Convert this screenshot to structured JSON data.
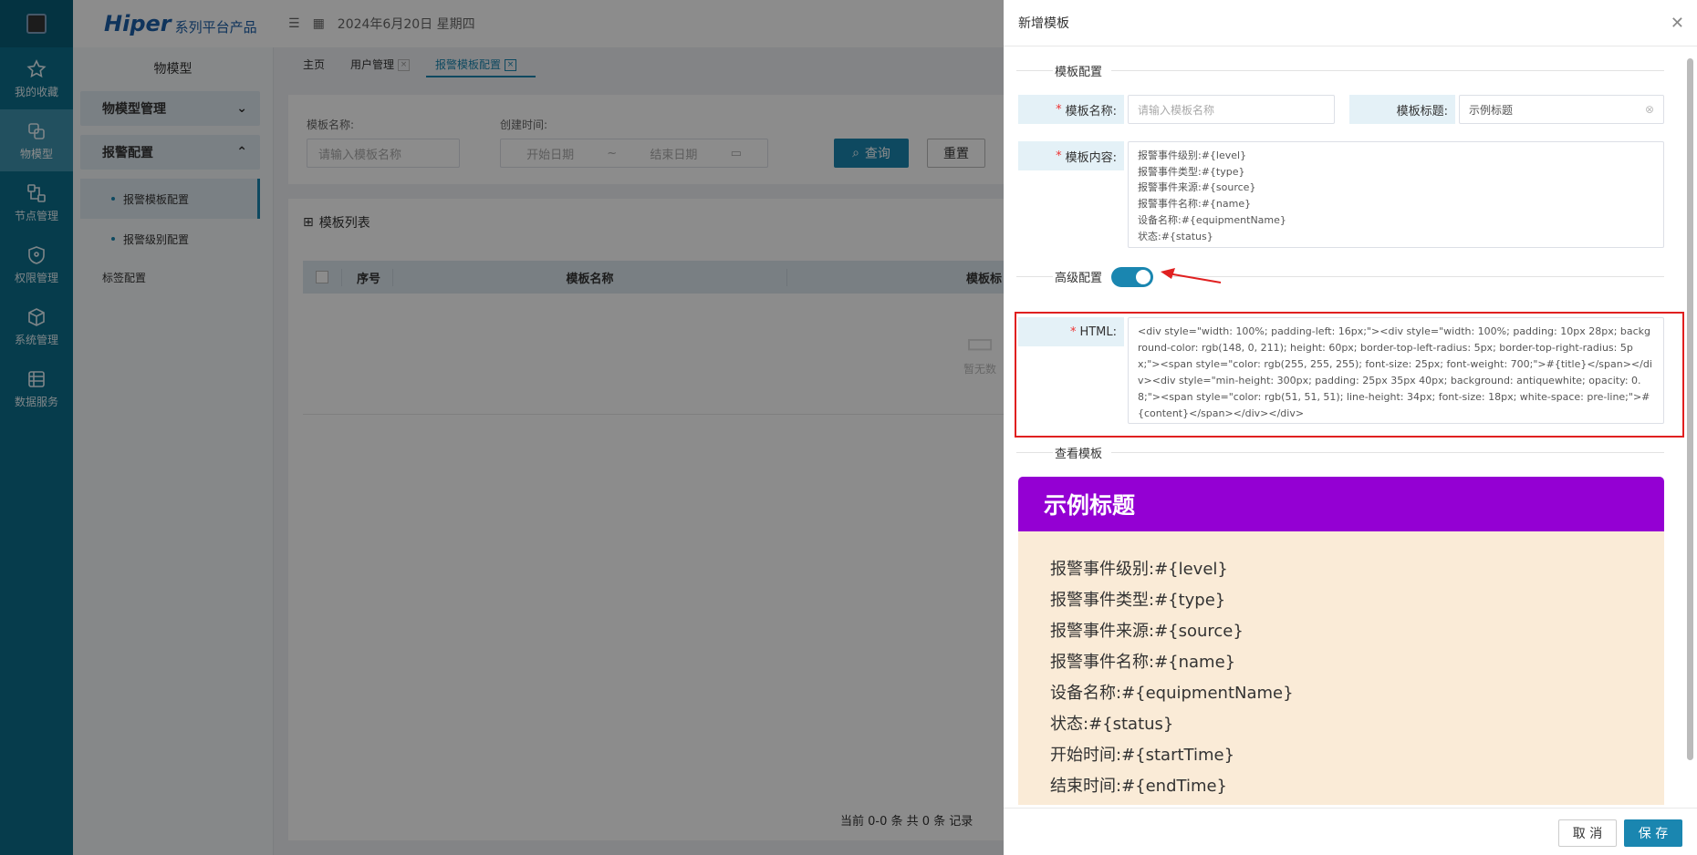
{
  "brand": {
    "name": "Hiper",
    "subtitle": "系列平台产品"
  },
  "leftbar": {
    "items": [
      {
        "label": "我的收藏",
        "icon": "star-icon"
      },
      {
        "label": "物模型",
        "icon": "model-icon"
      },
      {
        "label": "节点管理",
        "icon": "node-icon"
      },
      {
        "label": "权限管理",
        "icon": "shield-icon"
      },
      {
        "label": "系统管理",
        "icon": "cube-icon"
      },
      {
        "label": "数据服务",
        "icon": "data-icon"
      }
    ]
  },
  "sidebar": {
    "title": "物模型",
    "groups": [
      {
        "label": "物模型管理"
      },
      {
        "label": "报警配置"
      }
    ],
    "sub_items": [
      {
        "label": "报警模板配置"
      },
      {
        "label": "报警级别配置"
      }
    ],
    "plain_item": "标签配置"
  },
  "topbar": {
    "date": "2024年6月20日 星期四"
  },
  "tabs": [
    {
      "label": "主页"
    },
    {
      "label": "用户管理"
    },
    {
      "label": "报警模板配置"
    }
  ],
  "filter": {
    "name_label": "模板名称:",
    "name_placeholder": "请输入模板名称",
    "time_label": "创建时间:",
    "start_placeholder": "开始日期",
    "sep": "~",
    "end_placeholder": "结束日期",
    "query": "查询",
    "reset": "重置"
  },
  "list": {
    "title": "模板列表",
    "col_index": "序号",
    "col_name": "模板名称",
    "col_title": "模板标",
    "empty": "暂无数",
    "pager": "当前 0-0 条 共 0 条 记录"
  },
  "drawer": {
    "title": "新增模板",
    "section_config": "模板配置",
    "name_label": "模板名称:",
    "name_placeholder": "请输入模板名称",
    "title_label": "模板标题:",
    "title_value": "示例标题",
    "content_label": "模板内容:",
    "content_lines": [
      "报警事件级别:#{level}",
      "报警事件类型:#{type}",
      "报警事件来源:#{source}",
      "报警事件名称:#{name}",
      "设备名称:#{equipmentName}",
      "状态:#{status}"
    ],
    "advanced_label": "高级配置",
    "advanced_on": true,
    "html_label": "HTML:",
    "html_value": "<div style=\"width: 100%; padding-left: 16px;\"><div style=\"width: 100%; padding: 10px 28px; background-color: rgb(148, 0, 211); height: 60px; border-top-left-radius: 5px; border-top-right-radius: 5px;\"><span style=\"color: rgb(255, 255, 255); font-size: 25px; font-weight: 700;\">#{title}</span></div><div style=\"min-height: 300px; padding: 25px 35px 40px; background: antiquewhite; opacity: 0.8;\"><span style=\"color: rgb(51, 51, 51); line-height: 34px; font-size: 18px; white-space: pre-line;\">#{content}</span></div></div>",
    "section_preview": "查看模板",
    "preview_title": "示例标题",
    "preview_lines": [
      "报警事件级别:#{level}",
      "报警事件类型:#{type}",
      "报警事件来源:#{source}",
      "报警事件名称:#{name}",
      "设备名称:#{equipmentName}",
      "状态:#{status}",
      "开始时间:#{startTime}",
      "结束时间:#{endTime}"
    ],
    "cancel": "取 消",
    "save": "保 存"
  },
  "colors": {
    "primary": "#1a86b0",
    "sidebar_bg": "#0b6e8b",
    "preview_head": "#9400d3",
    "preview_body": "#faebd7",
    "highlight": "#e02020"
  }
}
